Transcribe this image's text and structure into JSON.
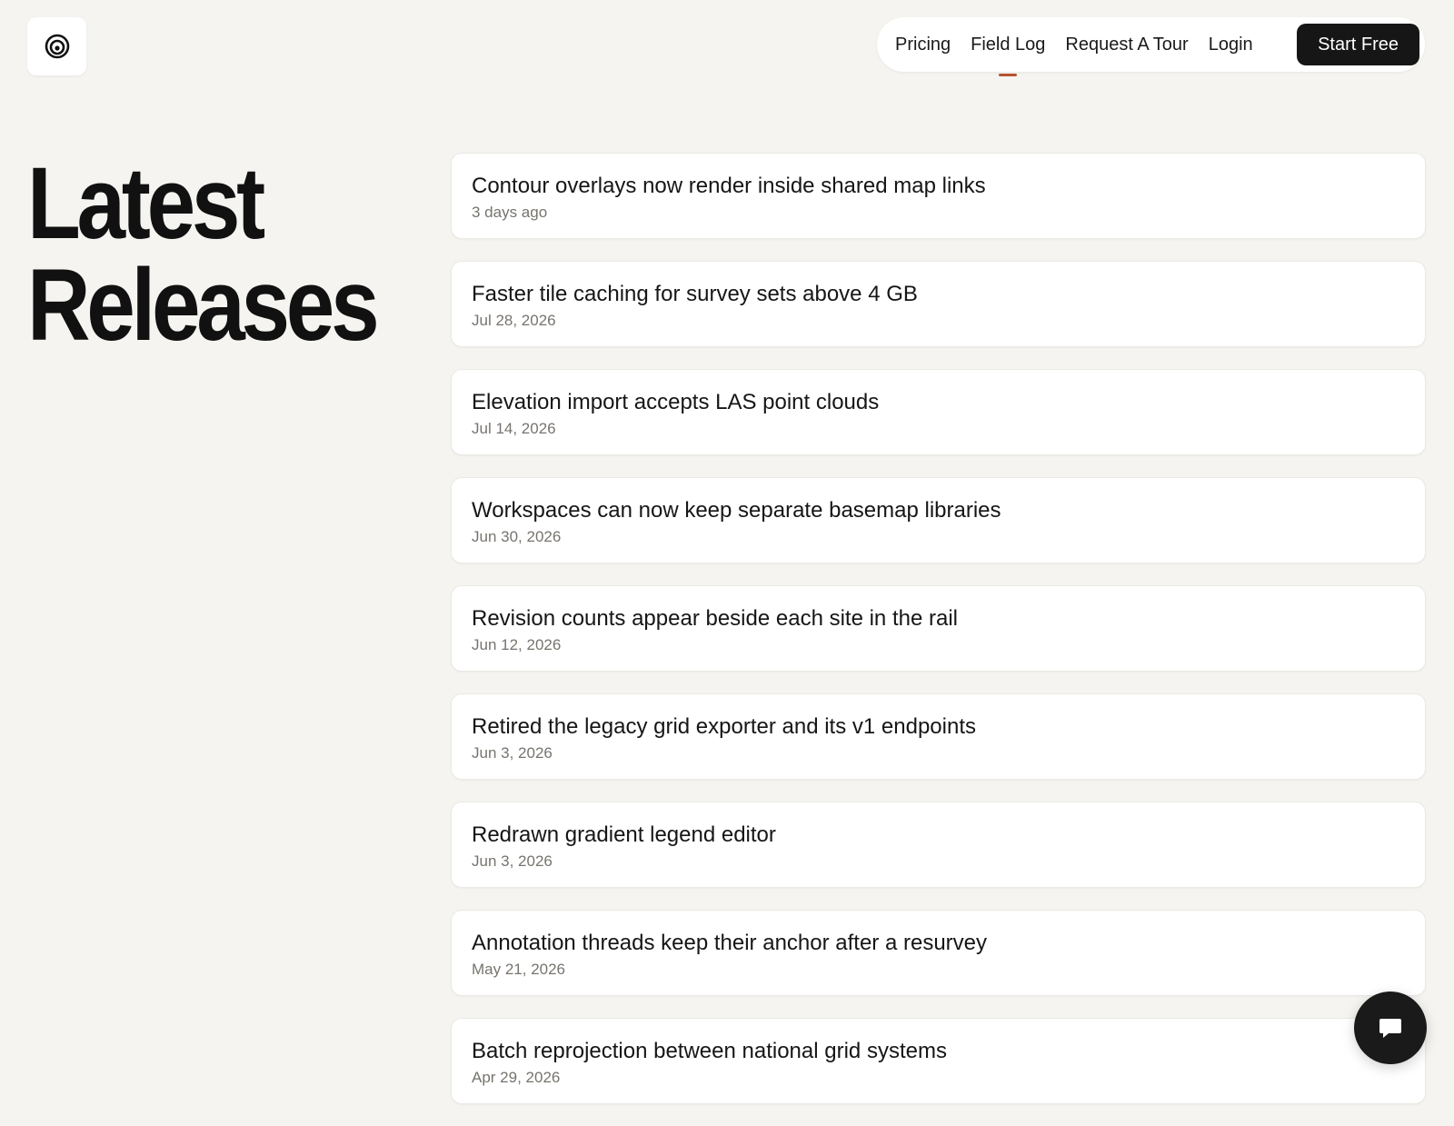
{
  "brand": {
    "logo_icon": "concentric-circles-icon"
  },
  "nav": {
    "links": [
      {
        "label": "Pricing",
        "active": false
      },
      {
        "label": "Field Log",
        "active": true
      },
      {
        "label": "Request A Tour",
        "active": false
      },
      {
        "label": "Login",
        "active": false
      }
    ],
    "cta_label": "Start Free"
  },
  "page": {
    "title_line1": "Latest",
    "title_line2": "Releases"
  },
  "releases": [
    {
      "title": "Contour overlays now render inside shared map links",
      "date": "3 days ago"
    },
    {
      "title": "Faster tile caching for survey sets above 4 GB",
      "date": "Jul 28, 2026"
    },
    {
      "title": "Elevation import accepts LAS point clouds",
      "date": "Jul 14, 2026"
    },
    {
      "title": "Workspaces can now keep separate basemap libraries",
      "date": "Jun 30, 2026"
    },
    {
      "title": "Revision counts appear beside each site in the rail",
      "date": "Jun 12, 2026"
    },
    {
      "title": "Retired the legacy grid exporter and its v1 endpoints",
      "date": "Jun 3, 2026"
    },
    {
      "title": "Redrawn gradient legend editor",
      "date": "Jun 3, 2026"
    },
    {
      "title": "Annotation threads keep their anchor after a resurvey",
      "date": "May 21, 2026"
    },
    {
      "title": "Batch reprojection between national grid systems",
      "date": "Apr 29, 2026"
    }
  ],
  "chat": {
    "icon": "chat-bubble-icon"
  },
  "colors": {
    "background": "#f5f4f0",
    "accent": "#b5532e",
    "cta": "#161616"
  }
}
